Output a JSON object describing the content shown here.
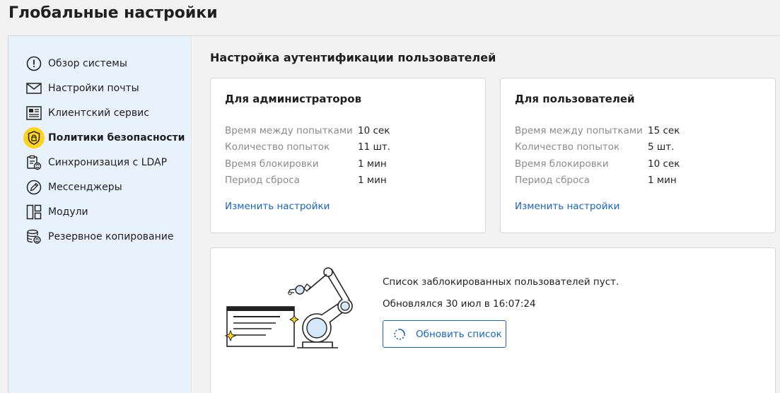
{
  "page": {
    "title": "Глобальные настройки"
  },
  "sidebar": {
    "items": [
      {
        "label": "Обзор системы",
        "icon": "info-icon"
      },
      {
        "label": "Настройки почты",
        "icon": "mail-icon"
      },
      {
        "label": "Клиентский сервис",
        "icon": "newspaper-icon"
      },
      {
        "label": "Политики безопасности",
        "icon": "shield-lock-icon",
        "active": true
      },
      {
        "label": "Синхронизация с LDAP",
        "icon": "sync-clipboard-icon"
      },
      {
        "label": "Мессенджеры",
        "icon": "pen-circle-icon"
      },
      {
        "label": "Модули",
        "icon": "modules-icon"
      },
      {
        "label": "Резервное копирование",
        "icon": "database-backup-icon"
      }
    ]
  },
  "main": {
    "section_title": "Настройка аутентификации пользователей",
    "admins": {
      "title": "Для администраторов",
      "params": [
        {
          "label": "Время между попытками",
          "value": "10 сек"
        },
        {
          "label": "Количество попыток",
          "value": "11 шт."
        },
        {
          "label": "Время блокировки",
          "value": "1 мин"
        },
        {
          "label": "Период сброса",
          "value": "1 мин"
        }
      ],
      "link": "Изменить настройки"
    },
    "users": {
      "title": "Для пользователей",
      "params": [
        {
          "label": "Время между попытками",
          "value": "15 сек"
        },
        {
          "label": "Количество попыток",
          "value": "5 шт."
        },
        {
          "label": "Время блокировки",
          "value": "10 сек"
        },
        {
          "label": "Период сброса",
          "value": "1 мин"
        }
      ],
      "link": "Изменить настройки"
    },
    "blocked": {
      "empty_text": "Список заблокированных пользователей пуст.",
      "updated_text": "Обновлялся 30 июл в 16:07:24",
      "refresh_label": "Обновить список"
    }
  },
  "colors": {
    "accent": "#1565c0",
    "active_icon_bg": "#ffd21e",
    "sidebar_bg": "#e8f2fc"
  }
}
